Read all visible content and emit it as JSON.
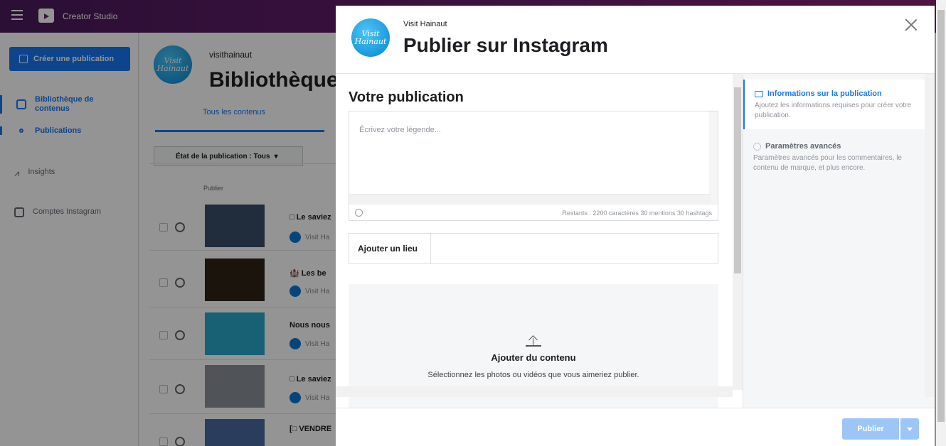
{
  "app": {
    "title": "Creator Studio"
  },
  "sidebar": {
    "create_label": "Créer une publication",
    "items": [
      {
        "label": "Bibliothèque de contenus"
      },
      {
        "label": "Publications"
      },
      {
        "label": "Insights"
      },
      {
        "label": "Comptes Instagram"
      }
    ]
  },
  "main": {
    "account": "visithainaut",
    "title": "Bibliothèque",
    "tab": "Tous les contenus",
    "filter_label": "État de la publication : Tous",
    "column_header": "Publier",
    "rows": [
      {
        "title": "□ Le saviez",
        "sub": "Visit Ha"
      },
      {
        "title": "🏰 Les be",
        "sub": "Visit Ha"
      },
      {
        "title": "Nous nous",
        "sub": "Visit Ha"
      },
      {
        "title": "□ Le saviez",
        "sub": "Visit Ha"
      },
      {
        "title": "[□ VENDRE",
        "sub": ""
      }
    ]
  },
  "avatar_text": "Visit Hainaut",
  "modal": {
    "account": "Visit Hainaut",
    "title": "Publier sur Instagram",
    "section_title": "Votre publication",
    "caption_placeholder": "Écrivez votre légende...",
    "remaining": "Restants : 2200 caractères 30 mentions 30 hashtags",
    "location_label": "Ajouter un lieu",
    "upload_title": "Ajouter du contenu",
    "upload_sub": "Sélectionnez les photos ou vidéos que vous aimeriez publier.",
    "steps": [
      {
        "title": "Informations sur la publication",
        "desc": "Ajoutez les informations requises pour créer votre publication."
      },
      {
        "title": "Paramètres avancés",
        "desc": "Paramètres avancés pour les commentaires, le contenu de marque, et plus encore."
      }
    ],
    "publish_label": "Publier"
  },
  "colors": {
    "accent": "#1877f2",
    "header": "#6b1f6f",
    "publish_disabled": "#9cc6f6"
  }
}
